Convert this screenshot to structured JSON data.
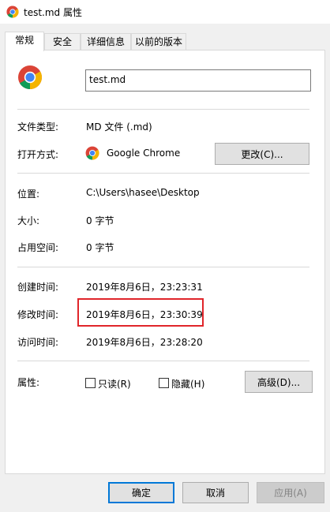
{
  "window": {
    "title": "test.md 属性"
  },
  "tabs": [
    "常规",
    "安全",
    "详细信息",
    "以前的版本"
  ],
  "file_name": "test.md",
  "file_type": {
    "label": "文件类型:",
    "value": "MD 文件 (.md)"
  },
  "opens_with": {
    "label": "打开方式:",
    "app": "Google Chrome",
    "change_button": "更改(C)..."
  },
  "location": {
    "label": "位置:",
    "value": "C:\\Users\\hasee\\Desktop"
  },
  "size": {
    "label": "大小:",
    "value": "0 字节"
  },
  "size_on_disk": {
    "label": "占用空间:",
    "value": "0 字节"
  },
  "created": {
    "label": "创建时间:",
    "value": "2019年8月6日，23:23:31"
  },
  "modified": {
    "label": "修改时间:",
    "value": "2019年8月6日，23:30:39"
  },
  "accessed": {
    "label": "访问时间:",
    "value": "2019年8月6日，23:28:20"
  },
  "attributes": {
    "label": "属性:",
    "readonly": "只读(R)",
    "hidden": "隐藏(H)",
    "advanced_button": "高级(D)..."
  },
  "footer": {
    "ok": "确定",
    "cancel": "取消",
    "apply": "应用(A)"
  },
  "colors": {
    "highlight": "#e0252a",
    "accent": "#0078d7"
  }
}
